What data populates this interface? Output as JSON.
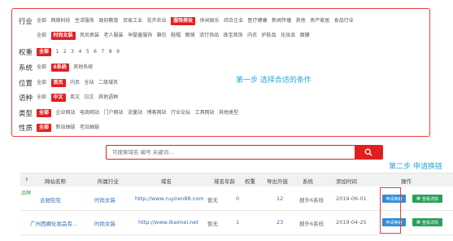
{
  "filters": {
    "industry": {
      "label": "行业",
      "options": [
        "全部",
        "网络科技",
        "生活服务",
        "政府教育",
        "贸易工业",
        "花卉农业",
        "服饰美妆",
        "休闲娱乐",
        "综合企业",
        "医疗健康",
        "新闻传播",
        "其他",
        "房产家居",
        "食品行业"
      ],
      "active": "服饰美妆"
    },
    "industry_sub": {
      "options": [
        "全部",
        "时尚女装",
        "风尚男装",
        "老人服装",
        "孕婴童服饰",
        "箱包",
        "鞋帽",
        "眼镜",
        "流行饰品",
        "珠宝首饰",
        "内衣",
        "护肤品",
        "化妆品",
        "面膜"
      ],
      "active": "时尚女装"
    },
    "weight": {
      "label": "权重",
      "options": [
        "全部",
        "1",
        "2",
        "3",
        "4",
        "5",
        "6",
        "7",
        "8",
        "9"
      ],
      "active": "全部"
    },
    "system": {
      "label": "系统",
      "options": [
        "全部",
        "6系统",
        "其他系统"
      ],
      "active": "6系统"
    },
    "position": {
      "label": "位置",
      "options": [
        "全部",
        "首页",
        "内页",
        "全站",
        "二级域名"
      ],
      "active": "首页"
    },
    "language": {
      "label": "语种",
      "options": [
        "全部",
        "中文",
        "英文",
        "日文",
        "其他语种"
      ],
      "active": "中文"
    },
    "type": {
      "label": "类型",
      "options": [
        "全部",
        "企业网站",
        "电商网站",
        "门户网站",
        "流量站",
        "博客网站",
        "行业论坛",
        "工具网站",
        "其他类型"
      ],
      "active": "全部"
    },
    "nature": {
      "label": "性质",
      "options": [
        "全部",
        "新站抽链",
        "老站抽链"
      ],
      "active": "全部"
    }
  },
  "annotations": {
    "step1": "第一步  选择合适的条件",
    "step2": "第二步  申请换链"
  },
  "search": {
    "placeholder": "可搜索域名 编号 关键词..."
  },
  "table": {
    "headers": [
      "?",
      "网站名称",
      "所属行业",
      "域名",
      "域名年龄",
      "权重",
      "导出外链",
      "系统",
      "添加时间",
      "操作"
    ],
    "rows": [
      {
        "tag": "品牌",
        "name": "古驰包包",
        "industry": "时尚女装",
        "domain": "http://www.ruyiren88.com",
        "age": "暂无",
        "weight": "0",
        "outlinks": "12",
        "system": "搜外6系统",
        "date": "2019-06-01",
        "apply": "申请换链",
        "detail": "查看详情"
      },
      {
        "tag": "",
        "name": "广州西娜化妆品有...",
        "industry": "时尚女装",
        "domain": "http://www.ibaimei.net",
        "age": "暂无",
        "weight": "1",
        "outlinks": "23",
        "system": "搜外6系统",
        "date": "2019-04-25",
        "apply": "申请换链",
        "detail": "查看详情"
      }
    ]
  },
  "colors": {
    "accent": "#e02020",
    "step": "#2aa7d8",
    "link": "#2d6bb5",
    "apply": "#2f8fd6",
    "detail": "#2e9e5b"
  }
}
